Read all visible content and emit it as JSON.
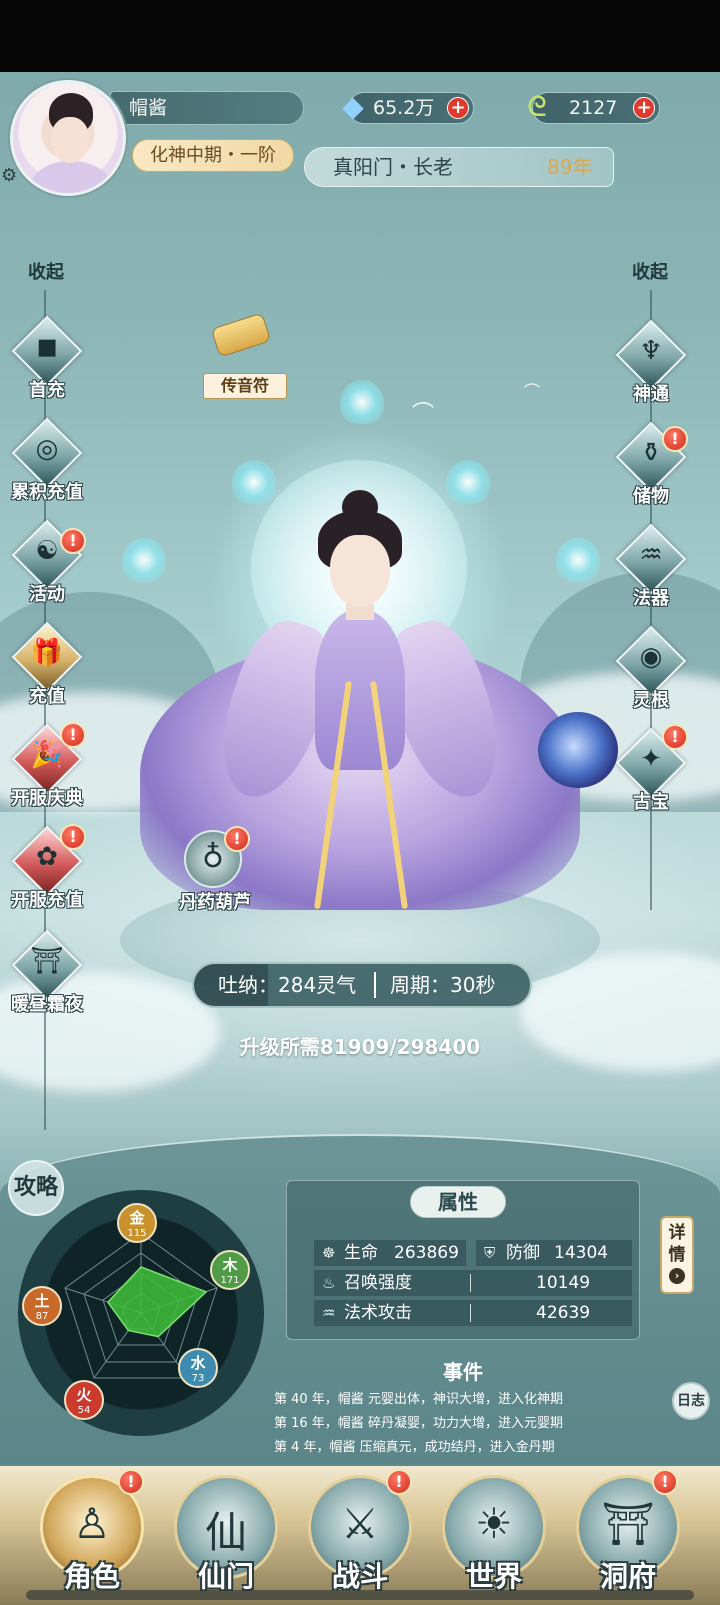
{
  "header": {
    "player_name": "帽酱",
    "realm": "化神中期・一阶",
    "spirit_stones": "65.2万",
    "jade": "2127",
    "sect": "真阳门・长老",
    "age": "89年",
    "settings_icon": "gear-icon"
  },
  "left_nav": {
    "collapse": "收起",
    "items": [
      {
        "label": "首充",
        "glyph": "◼",
        "alert": false
      },
      {
        "label": "累积充值",
        "glyph": "◎",
        "alert": false
      },
      {
        "label": "活动",
        "glyph": "☯",
        "alert": true
      },
      {
        "label": "充值",
        "glyph": "🎁",
        "alert": false
      },
      {
        "label": "开服庆典",
        "glyph": "🎉",
        "alert": true
      },
      {
        "label": "开服充值",
        "glyph": "✿",
        "alert": true
      },
      {
        "label": "暖昼霜夜",
        "glyph": "⛩",
        "alert": false
      }
    ]
  },
  "right_nav": {
    "collapse": "收起",
    "items": [
      {
        "label": "神通",
        "glyph": "♆",
        "alert": false
      },
      {
        "label": "储物",
        "glyph": "⚱",
        "alert": true
      },
      {
        "label": "法器",
        "glyph": "♒",
        "alert": false
      },
      {
        "label": "灵根",
        "glyph": "◉",
        "alert": false
      },
      {
        "label": "古宝",
        "glyph": "✦",
        "alert": true
      }
    ]
  },
  "center": {
    "message_scroll": "传音符",
    "gourd": "丹药葫芦",
    "breath_rate": "吐纳：284灵气",
    "cycle": "周期：30秒",
    "upgrade": "升级所需81909/298400"
  },
  "strategy": "攻略",
  "elements": [
    {
      "name": "金",
      "value": "115",
      "color": "#c7922e"
    },
    {
      "name": "木",
      "value": "171",
      "color": "#4f9b46"
    },
    {
      "name": "水",
      "value": "73",
      "color": "#3d8cb0"
    },
    {
      "name": "火",
      "value": "54",
      "color": "#cc3a2e"
    },
    {
      "name": "土",
      "value": "87",
      "color": "#c8692a"
    }
  ],
  "attributes": {
    "title": "属性",
    "hp_label": "生命",
    "hp": "263869",
    "def_label": "防御",
    "def": "14304",
    "summon_label": "召唤强度",
    "summon": "10149",
    "spell_label": "法术攻击",
    "spell": "42639",
    "detail_button": "详情"
  },
  "events": {
    "title": "事件",
    "log_button": "日志",
    "lines": [
      "第 40 年，帽酱 元婴出体，神识大增，进入化神期",
      "第 16 年，帽酱 碎丹凝婴，功力大增，进入元婴期",
      "第 4 年，帽酱 压缩真元，成功结丹，进入金丹期"
    ]
  },
  "bottom_nav": [
    {
      "label": "角色",
      "glyph": "♙",
      "alert": true,
      "active": true
    },
    {
      "label": "仙门",
      "glyph": "仙",
      "alert": false,
      "active": false
    },
    {
      "label": "战斗",
      "glyph": "⚔",
      "alert": true,
      "active": false
    },
    {
      "label": "世界",
      "glyph": "☀",
      "alert": false,
      "active": false
    },
    {
      "label": "洞府",
      "glyph": "⛩",
      "alert": true,
      "active": false
    }
  ]
}
